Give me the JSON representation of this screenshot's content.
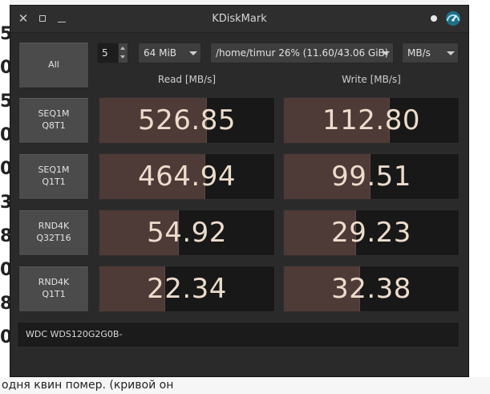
{
  "window": {
    "title": "KDiskMark"
  },
  "controls": {
    "all_label": "All",
    "loops_value": "5",
    "size_value": "64 MiB",
    "target_value": "/home/timur 26% (11.60/43.06 GiB)",
    "unit_value": "MB/s"
  },
  "headers": {
    "read": "Read [MB/s]",
    "write": "Write [MB/s]"
  },
  "tests": [
    {
      "label": "SEQ1M\nQ8T1",
      "read": "526.85",
      "write": "112.80",
      "read_level": 0.61,
      "write_level": 0.6
    },
    {
      "label": "SEQ1M\nQ1T1",
      "read": "464.94",
      "write": "99.51",
      "read_level": 0.6,
      "write_level": 0.49
    },
    {
      "label": "RND4K\nQ32T16",
      "read": "54.92",
      "write": "29.23",
      "read_level": 0.45,
      "write_level": 0.41
    },
    {
      "label": "RND4K\nQ1T1",
      "read": "22.34",
      "write": "32.38",
      "read_level": 0.37,
      "write_level": 0.43
    }
  ],
  "device": {
    "name": "WDC WDS120G2G0B-"
  },
  "background": {
    "bottom_text": "одня квин помер. (кривой он"
  },
  "icons": {
    "close": "close-icon",
    "maximize": "maximize-icon",
    "minimize": "minimize-icon",
    "app": "gauge-icon"
  },
  "colors": {
    "bar_fill": "#4e3a37",
    "value_text": "#ecdccb",
    "window_bg": "#2a2a2a"
  }
}
